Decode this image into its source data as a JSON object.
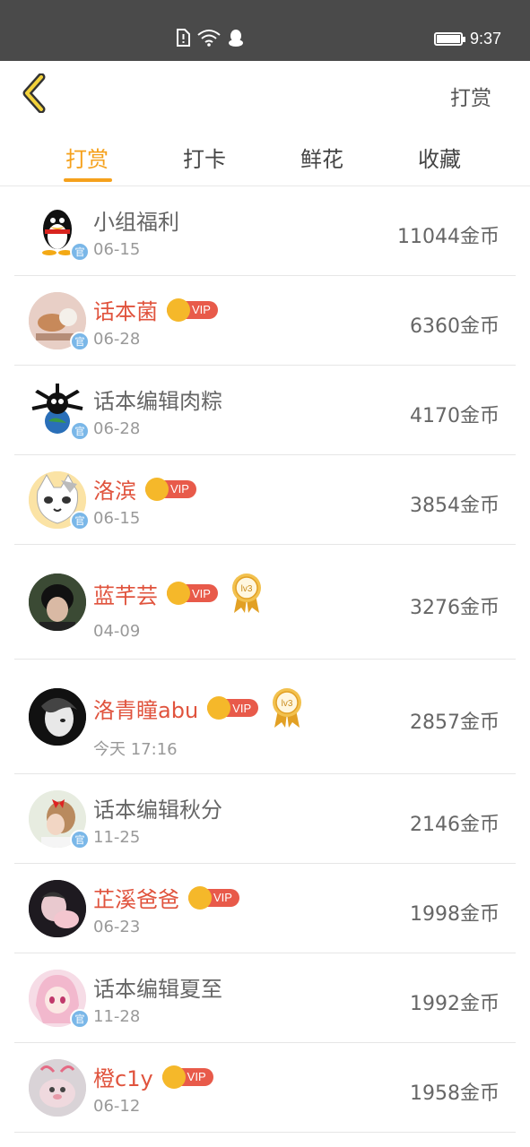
{
  "status_bar": {
    "time": "9:37",
    "icons": [
      "sim-alert-icon",
      "wifi-icon",
      "qq-icon"
    ]
  },
  "header": {
    "back_icon": "chevron-left-icon",
    "action_label": "打赏"
  },
  "tabs": [
    {
      "label": "打赏",
      "active": true
    },
    {
      "label": "打卡",
      "active": false
    },
    {
      "label": "鲜花",
      "active": false
    },
    {
      "label": "收藏",
      "active": false
    }
  ],
  "colors": {
    "accent": "#f5a11c",
    "vip_name": "#e0533d",
    "normal_name": "#666666",
    "official_badge": "#7ab7e8"
  },
  "rows": [
    {
      "name": "小组福利",
      "date": "06-15",
      "coins": "11044金币",
      "vip": false,
      "vip_label": "",
      "official": true,
      "official_label": "官",
      "medal": false,
      "medal_label": ""
    },
    {
      "name": "话本菌",
      "date": "06-28",
      "coins": "6360金币",
      "vip": true,
      "vip_label": "VIP",
      "official": true,
      "official_label": "官",
      "medal": false,
      "medal_label": ""
    },
    {
      "name": "话本编辑肉粽",
      "date": "06-28",
      "coins": "4170金币",
      "vip": false,
      "vip_label": "",
      "official": true,
      "official_label": "官",
      "medal": false,
      "medal_label": ""
    },
    {
      "name": "洛滨",
      "date": "06-15",
      "coins": "3854金币",
      "vip": true,
      "vip_label": "VIP",
      "official": true,
      "official_label": "官",
      "medal": false,
      "medal_label": ""
    },
    {
      "name": "蓝芊芸",
      "date": "04-09",
      "coins": "3276金币",
      "vip": true,
      "vip_label": "VIP",
      "official": false,
      "official_label": "",
      "medal": true,
      "medal_label": "lv3"
    },
    {
      "name": "洛青瞳abu",
      "date": "今天 17:16",
      "coins": "2857金币",
      "vip": true,
      "vip_label": "VIP",
      "official": false,
      "official_label": "",
      "medal": true,
      "medal_label": "lv3"
    },
    {
      "name": "话本编辑秋分",
      "date": "11-25",
      "coins": "2146金币",
      "vip": false,
      "vip_label": "",
      "official": true,
      "official_label": "官",
      "medal": false,
      "medal_label": ""
    },
    {
      "name": "芷溪爸爸",
      "date": "06-23",
      "coins": "1998金币",
      "vip": true,
      "vip_label": "VIP",
      "official": false,
      "official_label": "",
      "medal": false,
      "medal_label": ""
    },
    {
      "name": "话本编辑夏至",
      "date": "11-28",
      "coins": "1992金币",
      "vip": false,
      "vip_label": "",
      "official": true,
      "official_label": "官",
      "medal": false,
      "medal_label": ""
    },
    {
      "name": "橙c1y",
      "date": "06-12",
      "coins": "1958金币",
      "vip": true,
      "vip_label": "VIP",
      "official": false,
      "official_label": "",
      "medal": false,
      "medal_label": ""
    }
  ]
}
